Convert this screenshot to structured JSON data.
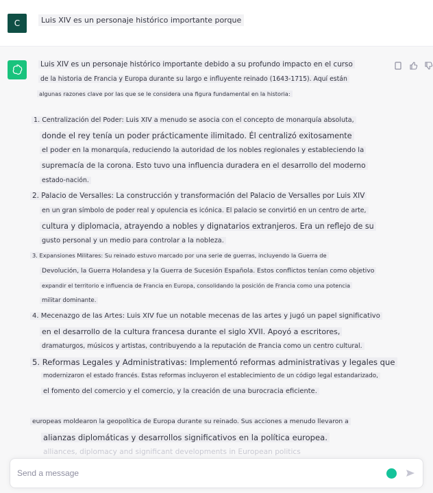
{
  "user": {
    "avatar_letter": "C",
    "message": "Luis XIV es un personaje histórico importante porque"
  },
  "assistant": {
    "lines": [
      "Luis XIV es un personaje histórico importante debido a su profundo impacto en el curso",
      "de la historia de Francia y Europa durante su largo e influyente reinado (1643-1715). Aquí están",
      "algunas razones clave por las que se le considera una figura fundamental en la historia:",
      "",
      "1. Centralización del Poder: Luis XIV a menudo se asocia con el concepto de monarquía absoluta,",
      "donde el rey tenía un poder prácticamente ilimitado. Él centralizó exitosamente",
      "el poder en la monarquía, reduciendo la autoridad de los nobles regionales y estableciendo la",
      "supremacía de la corona. Esto tuvo una influencia duradera en el desarrollo del moderno",
      "estado-nación.",
      "2. Palacio de Versalles: La construcción y transformación del Palacio de Versalles por Luis XIV",
      "en un gran símbolo de poder real y opulencia es icónica. El palacio se convirtió en un centro de arte,",
      "cultura y diplomacia, atrayendo a nobles y dignatarios extranjeros. Era un reflejo de su",
      "gusto personal y un medio para controlar a la nobleza.",
      "3. Expansiones Militares: Su reinado estuvo marcado por una serie de guerras, incluyendo la Guerra de",
      "Devolución, la Guerra Holandesa y la Guerra de Sucesión Española. Estos conflictos tenían como objetivo",
      "expandir el territorio e influencia de Francia en Europa, consolidando la posición de Francia como una potencia",
      "militar dominante.",
      "4. Mecenazgo de las Artes: Luis XIV fue un notable mecenas de las artes y jugó un papel significativo",
      "en el desarrollo de la cultura francesa durante el siglo XVII. Apoyó a escritores,",
      "dramaturgos, músicos y artistas, contribuyendo a la reputación de Francia como un centro cultural.",
      "5. Reformas Legales y Administrativas: Implementó reformas administrativas y legales que",
      "modernizaron el estado francés. Estas reformas incluyeron el establecimiento de un código legal estandarizado,",
      "el fomento del comercio y el comercio, y la creación de una burocracia eficiente.",
      "",
      "europeas moldearon la geopolítica de Europa durante su reinado. Sus acciones a menudo llevaron a",
      "alianzas diplomáticas y desarrollos significativos en la política europea.",
      "alliances, diplomacy and significant developments in European politics"
    ]
  },
  "composer": {
    "placeholder": "Send a message"
  }
}
